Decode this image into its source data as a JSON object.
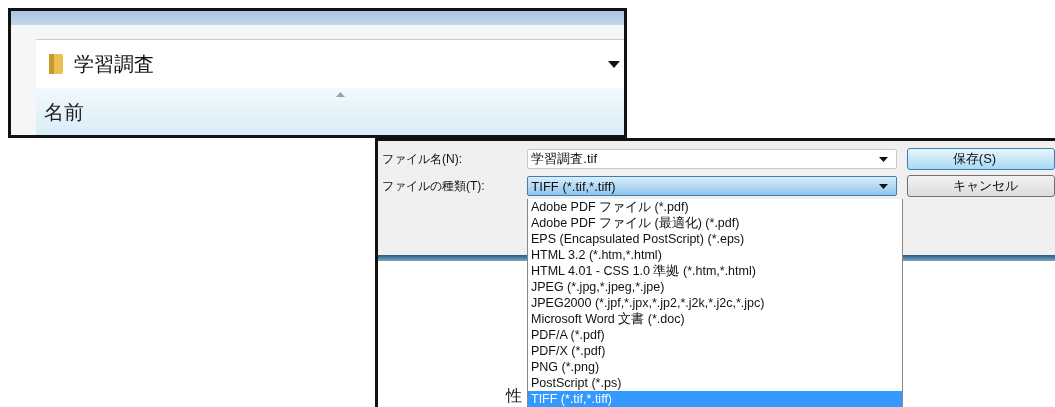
{
  "folder_panel": {
    "folder": "学習調査",
    "column_header": "名前"
  },
  "save_dialog": {
    "fields": [
      {
        "label": "ファイル名(N):",
        "value": "学習調査.tif",
        "active": false
      },
      {
        "label": "ファイルの種類(T):",
        "value": "TIFF (*.tif,*.tiff)",
        "active": true
      }
    ],
    "buttons": [
      {
        "label": "保存(S)",
        "default": true
      },
      {
        "label": "キャンセル",
        "default": false
      }
    ],
    "file_types": [
      {
        "label": "Adobe PDF ファイル (*.pdf)",
        "selected": false
      },
      {
        "label": "Adobe PDF ファイル (最適化) (*.pdf)",
        "selected": false
      },
      {
        "label": "EPS (Encapsulated PostScript) (*.eps)",
        "selected": false
      },
      {
        "label": "HTML 3.2 (*.htm,*.html)",
        "selected": false
      },
      {
        "label": "HTML 4.01 - CSS 1.0 準拠 (*.htm,*.html)",
        "selected": false
      },
      {
        "label": "JPEG (*.jpg,*.jpeg,*.jpe)",
        "selected": false
      },
      {
        "label": "JPEG2000 (*.jpf,*.jpx,*.jp2,*.j2k,*.j2c,*.jpc)",
        "selected": false
      },
      {
        "label": "Microsoft Word 文書 (*.doc)",
        "selected": false
      },
      {
        "label": "PDF/A (*.pdf)",
        "selected": false
      },
      {
        "label": "PDF/X (*.pdf)",
        "selected": false
      },
      {
        "label": "PNG (*.png)",
        "selected": false
      },
      {
        "label": "PostScript (*.ps)",
        "selected": false
      },
      {
        "label": "TIFF (*.tif,*.tiff)",
        "selected": true
      }
    ],
    "background_text": "性"
  }
}
